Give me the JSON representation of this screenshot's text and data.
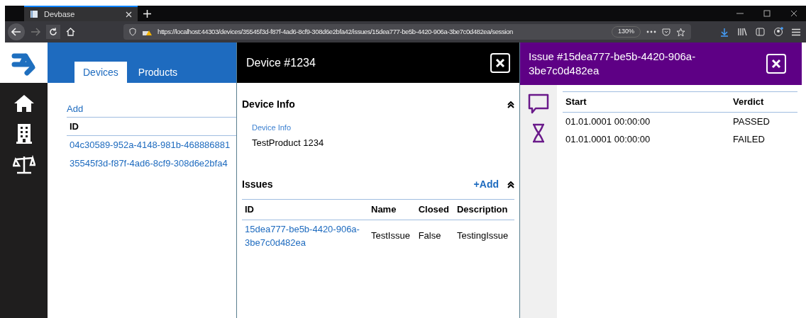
{
  "browser": {
    "tab_title": "Devbase",
    "url": "https://localhost:44303/devices/35545f3d-f87f-4ad6-8cf9-308d6e2bfa42/issues/15dea777-be5b-4420-906a-3be7c0d482ea/session",
    "zoom": "130%"
  },
  "nav_tabs": [
    {
      "label": "Devices",
      "selected": true
    },
    {
      "label": "Products",
      "selected": false
    }
  ],
  "devices": {
    "add": "Add",
    "column": "ID",
    "rows": [
      "04c30589-952a-4148-981b-468886881",
      "35545f3d-f87f-4ad6-8cf9-308d6e2bfa4"
    ]
  },
  "device_panel": {
    "title": "Device #1234",
    "info_section": {
      "title": "Device Info",
      "field_label": "Device Info",
      "field_value": "TestProduct 1234"
    },
    "issues_section": {
      "title": "Issues",
      "add": "+Add",
      "columns": [
        "ID",
        "Name",
        "Closed",
        "Description"
      ],
      "rows": [
        [
          "15dea777-be5b-4420-906a-3be7c0d482ea",
          "TestIssue",
          "False",
          "TestingIssue"
        ]
      ]
    }
  },
  "issue_panel": {
    "title": "Issue #15dea777-be5b-4420-906a-3be7c0d482ea",
    "columns": [
      "Start",
      "Verdict"
    ],
    "rows": [
      [
        "01.01.0001 00:00:00",
        "PASSED"
      ],
      [
        "01.01.0001 00:00:00",
        "FAILED"
      ]
    ]
  }
}
